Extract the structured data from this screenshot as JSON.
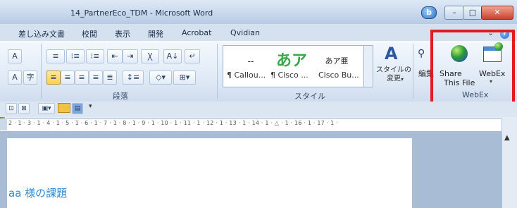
{
  "window": {
    "title": "14_PartnerEco_TDM - Microsoft Word",
    "badge_glyph": "b",
    "min_glyph": "–",
    "max_glyph": "□",
    "close_glyph": "✕"
  },
  "tabs": [
    {
      "label": "差し込み文書"
    },
    {
      "label": "校閲"
    },
    {
      "label": "表示"
    },
    {
      "label": "開発"
    },
    {
      "label": "Acrobat"
    },
    {
      "label": "Qvidian"
    }
  ],
  "help_glyph": "?",
  "ribbon_minimize_glyph": "⌄",
  "paragraph_group": {
    "label": "段落",
    "icons": [
      "≡",
      "⁝≡",
      "⇤",
      "⇥",
      "Ꭓ",
      "A↓",
      "↵"
    ]
  },
  "font_group_fragments": {
    "top_icon": "A",
    "bottom_icon_a": "A",
    "bottom_icon_b": "字"
  },
  "styles_group": {
    "label": "スタイル",
    "previews": [
      {
        "preview": "--",
        "name": "¶ Callou..."
      },
      {
        "preview": "あア",
        "name": "¶ Cisco ..."
      },
      {
        "preview": "あア亜",
        "name": "Cisco Bu..."
      }
    ],
    "change_styles_label": "スタイルの\n変更",
    "change_styles_caret": "▾",
    "edit_label": "編集"
  },
  "webex_group": {
    "label": "WebEx",
    "share_label_line1": "Share",
    "share_label_line2": "This File",
    "webex_label": "WebEx",
    "webex_caret": "▾"
  },
  "quick_access": {
    "caret": "▾"
  },
  "ruler": {
    "text": "2 · 1 · 3 · 1 · 4 · 1 · 5 · 1 · 6 · 1 · 7 · 1 · 8 · 1 · 9 · 1 · 10 · 1 · 11 · 1 · 12 · 1 · 13 · 1 · 14 · 1 · △ · 1 · 16 · 1 · 17 · 1 ·"
  },
  "document": {
    "heading": "aa 様の課題"
  },
  "scroll": {
    "up_glyph": "▲",
    "ruler_toggle_glyph": "⊡"
  },
  "colors": {
    "highlight_red": "#e11b22",
    "heading_blue": "#2e8bd6",
    "styles_green": "#3aa84a"
  }
}
